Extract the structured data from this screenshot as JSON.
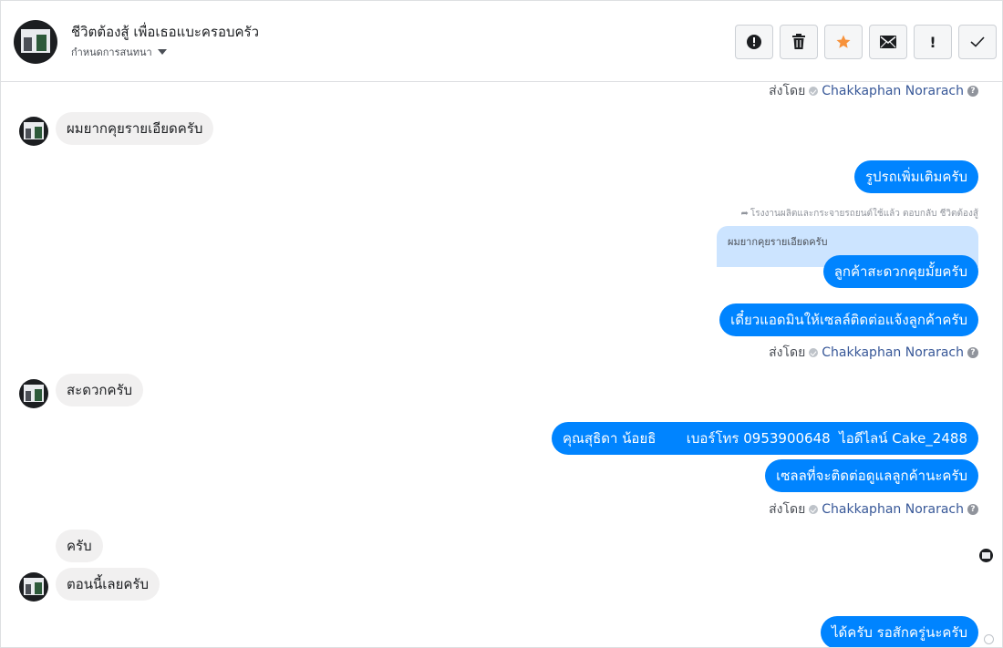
{
  "header": {
    "title": "ชีวิตต้องสู้ เพื่อเธอแบะครอบครัว",
    "subtitle": "กำหนดการสนทนา"
  },
  "toolbar": {
    "buttons": [
      {
        "name": "report",
        "icon": "alert-circle-icon"
      },
      {
        "name": "delete",
        "icon": "trash-icon"
      },
      {
        "name": "star",
        "icon": "star-icon",
        "color": "#f7923b"
      },
      {
        "name": "mail",
        "icon": "envelope-icon"
      },
      {
        "name": "spam",
        "icon": "exclamation-icon",
        "label": "!"
      },
      {
        "name": "done",
        "icon": "checkmark-icon"
      }
    ]
  },
  "thread": {
    "sent_by_label": "ส่งโดย",
    "sent_by_name": "Chakkaphan Norarach",
    "messages": [
      {
        "text": "ผมยากคุยรายเอียดครับ"
      },
      {
        "text": "รูปรถเพิ่มเติมครับ"
      },
      {
        "reply_meta": "โรงงานผลิตและกระจายรถยนต์ใช้แล้ว ตอบกลับ ชีวิตต้องสู้",
        "quoted": "ผมยากคุยรายเอียดครับ"
      },
      {
        "text": "ลูกค้าสะดวกคุยมั้ยครับ"
      },
      {
        "text": "เดี๋ยวแอดมินให้เซลล์ติดต่อแจ้งลูกค้าครับ"
      },
      {
        "text": "สะดวกครับ"
      },
      {
        "text": "คุณสุธิดา น้อยธิ       เบอร์โทร 0953900648  ไอดีไลน์ Cake_2488"
      },
      {
        "text": "เซลลที่จะติดต่อดูแลลูกค้านะครับ"
      },
      {
        "text": "ครับ"
      },
      {
        "text": "ตอนนี้เลยครับ"
      },
      {
        "text": "ได้ครับ รอสักครู่นะครับ"
      }
    ]
  },
  "colors": {
    "outgoing": "#0084ff",
    "incoming": "#f1f0f0",
    "quote": "#cce4ff",
    "link": "#385898"
  }
}
